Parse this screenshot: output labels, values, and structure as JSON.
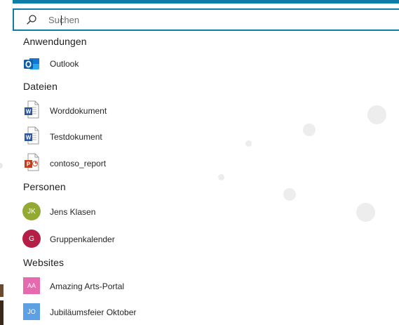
{
  "search": {
    "placeholder": "Suchen",
    "value": ""
  },
  "groups": {
    "apps": {
      "header": "Anwendungen",
      "items": [
        {
          "label": "Outlook",
          "icon": "outlook-icon"
        }
      ]
    },
    "files": {
      "header": "Dateien",
      "items": [
        {
          "label": "Worddokument",
          "icon": "word-document-icon"
        },
        {
          "label": "Testdokument",
          "icon": "word-document-icon"
        },
        {
          "label": "contoso_report",
          "icon": "powerpoint-document-icon"
        }
      ]
    },
    "people": {
      "header": "Personen",
      "items": [
        {
          "label": "Jens Klasen",
          "initials": "JK",
          "color": "#92a934"
        },
        {
          "label": "Gruppenkalender",
          "initials": "G",
          "color": "#b51e46"
        }
      ]
    },
    "sites": {
      "header": "Websites",
      "items": [
        {
          "label": "Amazing Arts-Portal",
          "initials": "AA",
          "color": "#e56aae"
        },
        {
          "label": "Jubiläumsfeier Oktober",
          "initials": "JO",
          "color": "#5ea0e4"
        }
      ]
    }
  },
  "colors": {
    "accent": "#0e7ea8",
    "word": "#2b579a",
    "powerpoint": "#c43e1c",
    "outlook": "#0f6cbd"
  }
}
